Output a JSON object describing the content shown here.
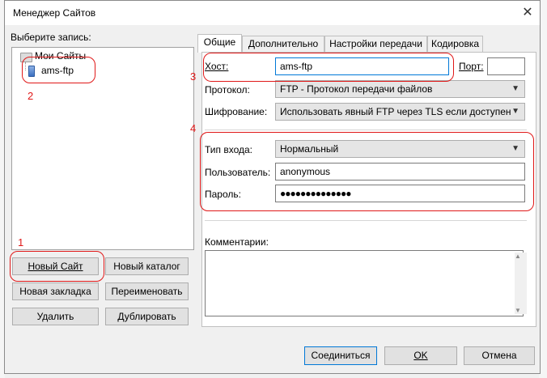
{
  "window": {
    "title": "Менеджер Сайтов",
    "close": "✕"
  },
  "left": {
    "select_label": "Выберите запись:",
    "tree": {
      "root": "Мои Сайты",
      "site": "ams-ftp"
    },
    "buttons": {
      "new_site": "Новый Сайт",
      "new_folder": "Новый каталог",
      "new_bookmark": "Новая закладка",
      "rename": "Переименовать",
      "delete": "Удалить",
      "duplicate": "Дублировать"
    }
  },
  "tabs": [
    "Общие",
    "Дополнительно",
    "Настройки передачи",
    "Кодировка"
  ],
  "general": {
    "host_label": "Хост:",
    "host_value": "ams-ftp",
    "port_label": "Порт:",
    "port_value": "",
    "protocol_label": "Протокол:",
    "protocol_value": "FTP - Протокол передачи файлов",
    "encryption_label": "Шифрование:",
    "encryption_value": "Использовать явный FTP через TLS если доступен",
    "logon_label": "Тип входа:",
    "logon_value": "Нормальный",
    "user_label": "Пользователь:",
    "user_value": "anonymous",
    "password_label": "Пароль:",
    "password_value": "●●●●●●●●●●●●●●",
    "comments_label": "Комментарии:"
  },
  "footer": {
    "connect": "Соединиться",
    "ok": "OK",
    "cancel": "Отмена"
  },
  "annotations": [
    "1",
    "2",
    "3",
    "4"
  ],
  "colors": {
    "annotation": "#e01818",
    "focus": "#0078d7"
  }
}
